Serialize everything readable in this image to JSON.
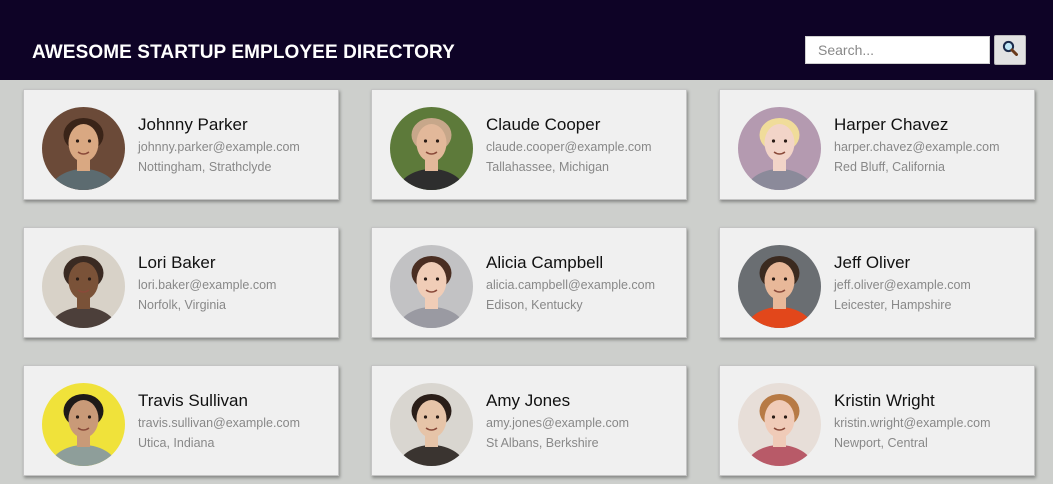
{
  "header": {
    "title": "AWESOME STARTUP EMPLOYEE DIRECTORY",
    "background": "#0e0326"
  },
  "search": {
    "placeholder": "Search...",
    "button_icon": "magnifying-glass-icon"
  },
  "employees": [
    {
      "name": "Johnny Parker",
      "email": "johnny.parker@example.com",
      "location": "Nottingham, Strathclyde",
      "avatar_bg": "#6b4a38",
      "skin": "#d9a882",
      "hair": "#3a2418",
      "shirt": "#5c6b70"
    },
    {
      "name": "Claude Cooper",
      "email": "claude.cooper@example.com",
      "location": "Tallahassee, Michigan",
      "avatar_bg": "#5d7a3a",
      "skin": "#e2b89a",
      "hair": "#c7a78a",
      "shirt": "#2e2e2e"
    },
    {
      "name": "Harper Chavez",
      "email": "harper.chavez@example.com",
      "location": "Red Bluff, California",
      "avatar_bg": "#b49ab0",
      "skin": "#f2d4c8",
      "hair": "#f0dc9a",
      "shirt": "#8b8a9a"
    },
    {
      "name": "Lori Baker",
      "email": "lori.baker@example.com",
      "location": "Norfolk, Virginia",
      "avatar_bg": "#d8d2c8",
      "skin": "#7a5238",
      "hair": "#3a2a22",
      "shirt": "#4c3f3a"
    },
    {
      "name": "Alicia Campbell",
      "email": "alicia.campbell@example.com",
      "location": "Edison, Kentucky",
      "avatar_bg": "#c2c2c4",
      "skin": "#f0cdb7",
      "hair": "#4a2e22",
      "shirt": "#9a9aa2"
    },
    {
      "name": "Jeff Oliver",
      "email": "jeff.oliver@example.com",
      "location": "Leicester, Hampshire",
      "avatar_bg": "#6a6e72",
      "skin": "#e8b899",
      "hair": "#3b2a1f",
      "shirt": "#e2471b"
    },
    {
      "name": "Travis Sullivan",
      "email": "travis.sullivan@example.com",
      "location": "Utica, Indiana",
      "avatar_bg": "#f0e23a",
      "skin": "#c99a78",
      "hair": "#1e1a18",
      "shirt": "#8e9e9a"
    },
    {
      "name": "Amy Jones",
      "email": "amy.jones@example.com",
      "location": "St Albans, Berkshire",
      "avatar_bg": "#d9d6d0",
      "skin": "#e6c4a8",
      "hair": "#2a1e18",
      "shirt": "#3a3430"
    },
    {
      "name": "Kristin Wright",
      "email": "kristin.wright@example.com",
      "location": "Newport, Central",
      "avatar_bg": "#e7ded8",
      "skin": "#f0cbb8",
      "hair": "#b77a45",
      "shirt": "#b85a68"
    }
  ]
}
